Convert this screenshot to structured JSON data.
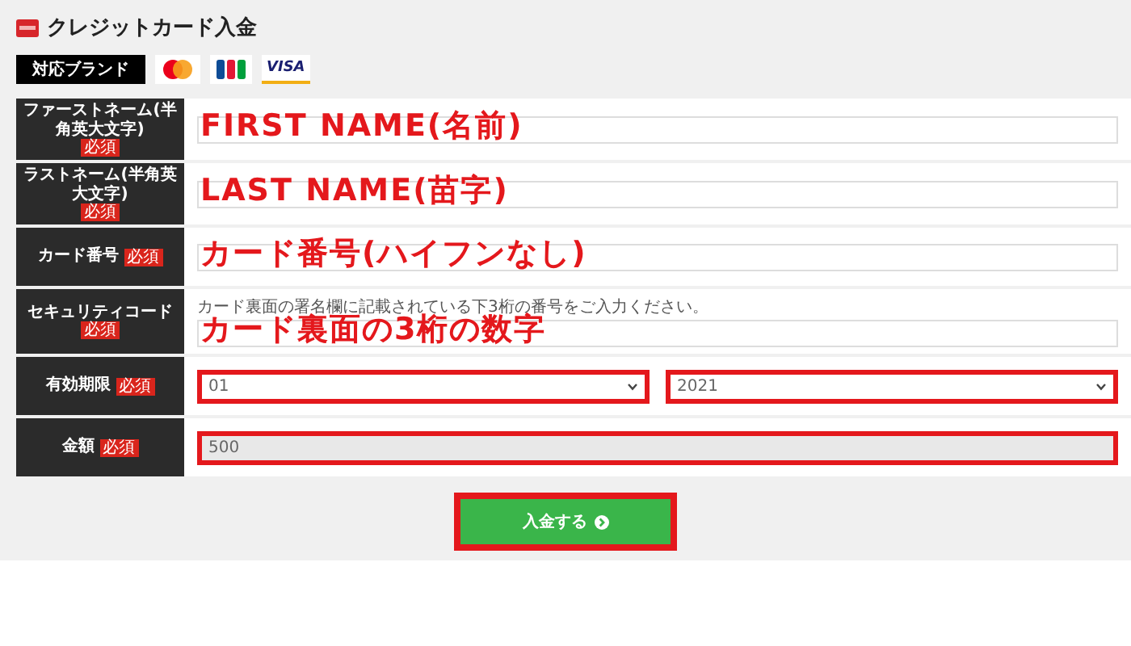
{
  "header": {
    "title": "クレジットカード入金"
  },
  "brands": {
    "label": "対応ブランド",
    "items": [
      {
        "kind": "mastercard"
      },
      {
        "kind": "jcb"
      },
      {
        "kind": "visa",
        "label": "VISA"
      }
    ]
  },
  "rows": [
    {
      "kind": "text",
      "label": "ファーストネーム(半角英大文字)",
      "badge": "必須",
      "annotation": "FIRST NAME(名前)"
    },
    {
      "kind": "text",
      "label": "ラストネーム(半角英大文字)",
      "badge": "必須",
      "annotation": "LAST NAME(苗字)"
    },
    {
      "kind": "text",
      "label": "カード番号",
      "badge": "必須",
      "annotation": "カード番号(ハイフンなし)"
    },
    {
      "kind": "text",
      "label": "セキュリティコード",
      "badge": "必須",
      "note": "カード裏面の署名欄に記載されている下3桁の番号をご入力ください。",
      "annotation": "カード裏面の3桁の数字"
    },
    {
      "kind": "selects",
      "label": "有効期限",
      "badge": "必須",
      "selects": [
        {
          "value": "01",
          "highlighted": true
        },
        {
          "value": "2021",
          "highlighted": true
        }
      ]
    },
    {
      "kind": "readonly",
      "label": "金額",
      "badge": "必須",
      "value": "500",
      "highlighted": true
    }
  ],
  "submit": {
    "label": "入金する",
    "highlighted": true
  }
}
